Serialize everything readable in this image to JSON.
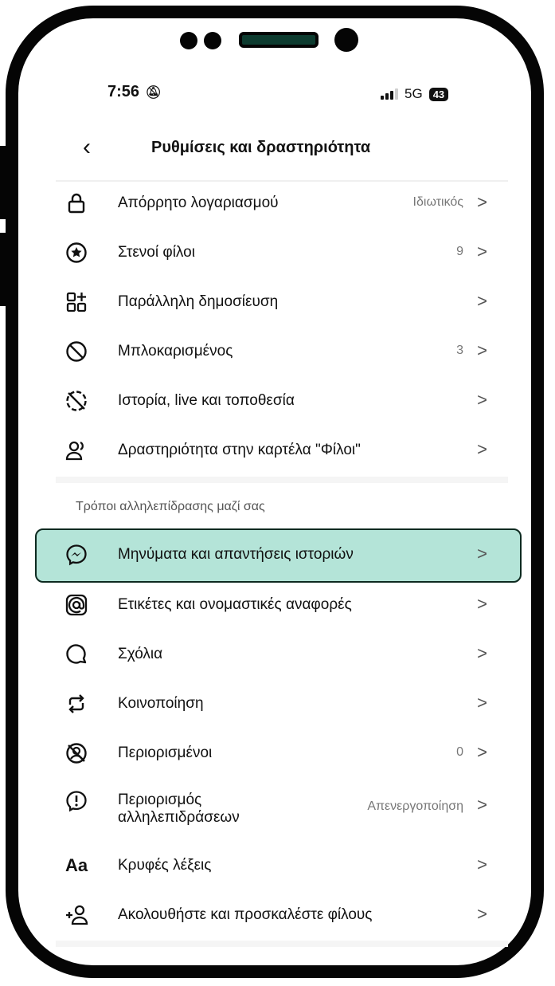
{
  "status_bar": {
    "time": "7:56",
    "network": "5G",
    "battery": "43"
  },
  "header": {
    "title": "Ρυθμίσεις και δραστηριότητα"
  },
  "items_top": [
    {
      "icon": "lock-icon",
      "label": "Απόρρητο λογαριασμού",
      "value": "Ιδιωτικός"
    },
    {
      "icon": "star-circle-icon",
      "label": "Στενοί φίλοι",
      "value": "9"
    },
    {
      "icon": "grid-plus-icon",
      "label": "Παράλληλη δημοσίευση",
      "value": ""
    },
    {
      "icon": "block-icon",
      "label": "Μπλοκαρισμένος",
      "value": "3"
    },
    {
      "icon": "story-off-icon",
      "label": "Ιστορία, live και τοποθεσία",
      "value": ""
    },
    {
      "icon": "friends-activity-icon",
      "label": "Δραστηριότητα στην καρτέλα \"Φίλοι\"",
      "value": ""
    }
  ],
  "section_title": "Τρόποι αλληλεπίδρασης μαζί σας",
  "items_bottom": [
    {
      "icon": "messenger-icon",
      "label": "Μηνύματα και απαντήσεις ιστοριών",
      "value": ""
    },
    {
      "icon": "at-icon",
      "label": "Ετικέτες και ονομαστικές αναφορές",
      "value": ""
    },
    {
      "icon": "comment-icon",
      "label": "Σχόλια",
      "value": ""
    },
    {
      "icon": "share-icon",
      "label": "Κοινοποίηση",
      "value": ""
    },
    {
      "icon": "restricted-icon",
      "label": "Περιορισμένοι",
      "value": "0"
    },
    {
      "icon": "limit-icon",
      "label_line1": "Περιορισμός",
      "label_line2": "αλληλεπιδράσεων",
      "value": "Απενεργοποίηση"
    },
    {
      "icon": "hidden-words-icon",
      "glyph": "Aa",
      "label": "Κρυφές λέξεις",
      "value": ""
    },
    {
      "icon": "add-friend-icon",
      "label": "Ακολουθήστε και προσκαλέστε φίλους",
      "value": ""
    }
  ],
  "colors": {
    "highlight_bg": "#b4e4d8",
    "frame": "#050505",
    "pill": "#0d3b2f"
  }
}
